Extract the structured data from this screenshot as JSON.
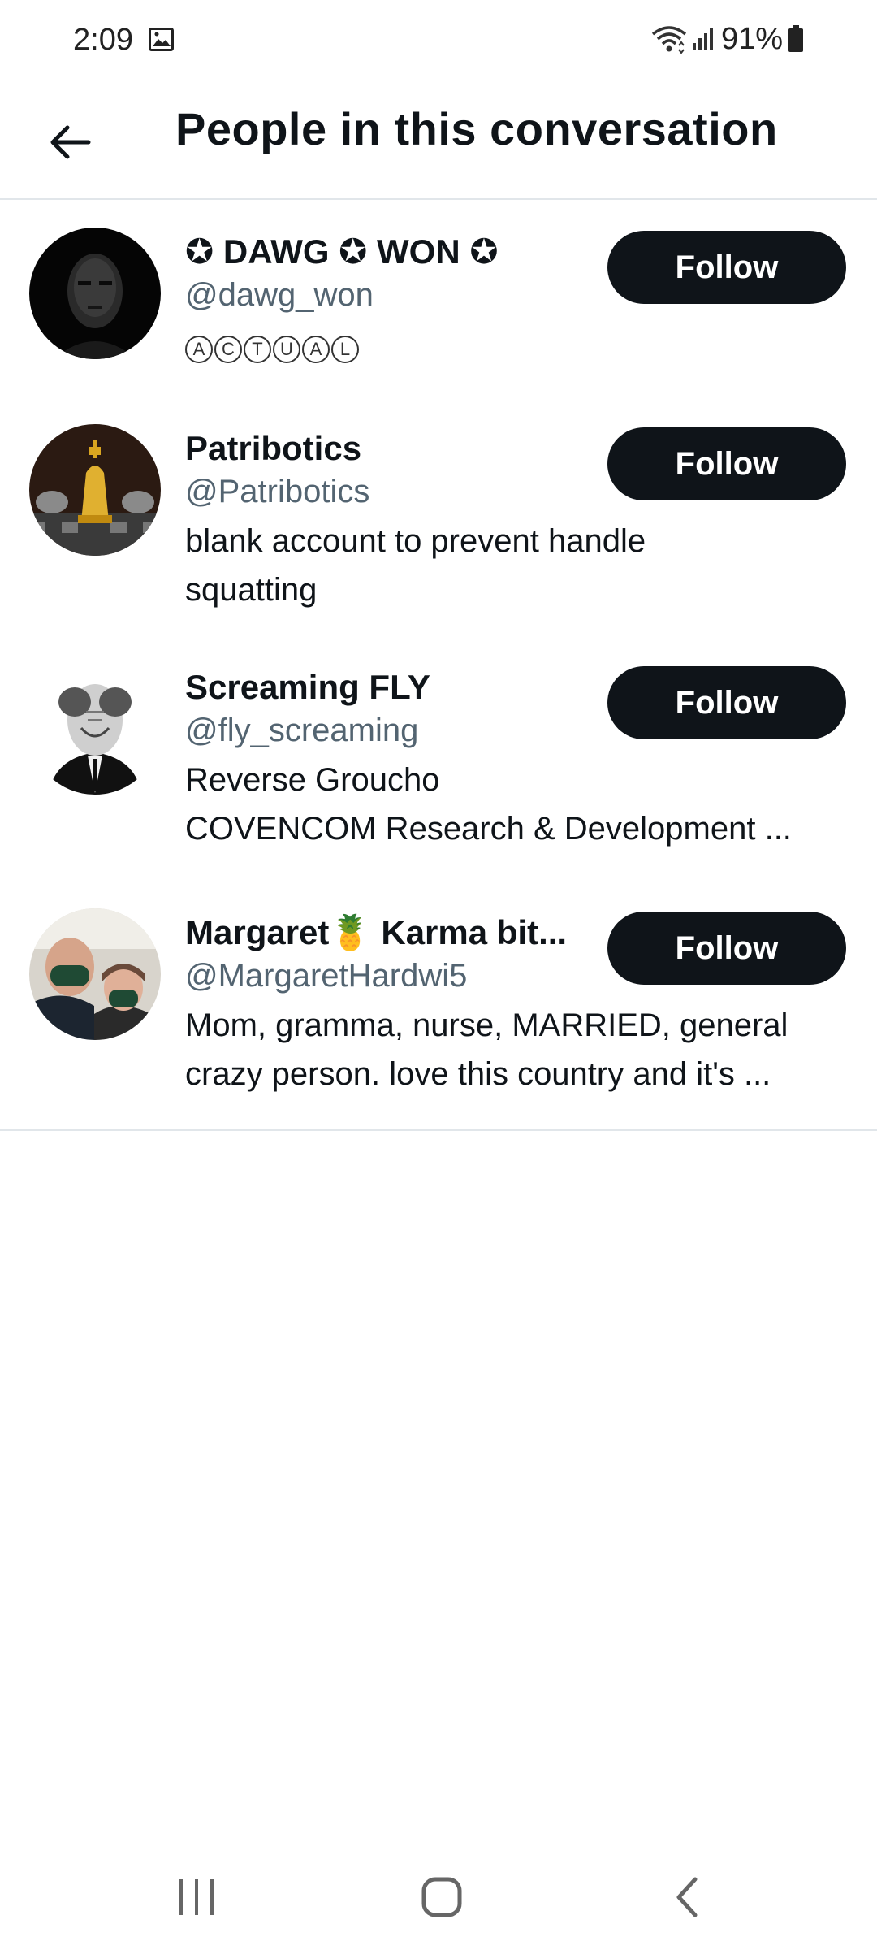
{
  "status_bar": {
    "time": "2:09",
    "battery": "91%"
  },
  "header": {
    "title": "People in this conversation"
  },
  "users": [
    {
      "display_name": "✪ DAWG ✪ WON ✪",
      "handle": "@dawg_won",
      "bio_circled": [
        "A",
        "C",
        "T",
        "U",
        "A",
        "L"
      ],
      "follow_label": "Follow"
    },
    {
      "display_name": "Patribotics",
      "handle": "@Patribotics",
      "bio_lines": [
        "blank account to prevent handle",
        "squatting"
      ],
      "follow_label": "Follow"
    },
    {
      "display_name": "Screaming FLY",
      "handle": "@fly_screaming",
      "bio_lines": [
        "Reverse Groucho",
        "COVENCOM Research & Development ..."
      ],
      "follow_label": "Follow"
    },
    {
      "display_name": "Margaret🍍 Karma bit...",
      "handle": "@MargaretHardwi5",
      "bio_lines": [
        "Mom, gramma, nurse, MARRIED, general",
        "crazy person. love this country and it's ..."
      ],
      "follow_label": "Follow"
    }
  ],
  "icons": {
    "back": "arrow-left-icon",
    "gallery": "image-icon",
    "wifi": "wifi-icon",
    "signal": "signal-icon",
    "battery": "battery-icon",
    "nav_recents": "recents-icon",
    "nav_home": "home-icon",
    "nav_back": "chevron-left-icon"
  },
  "colors": {
    "primary_text": "#0f1419",
    "secondary_text": "#536471",
    "button_bg": "#0f1419",
    "divider": "#e1e6ea"
  }
}
